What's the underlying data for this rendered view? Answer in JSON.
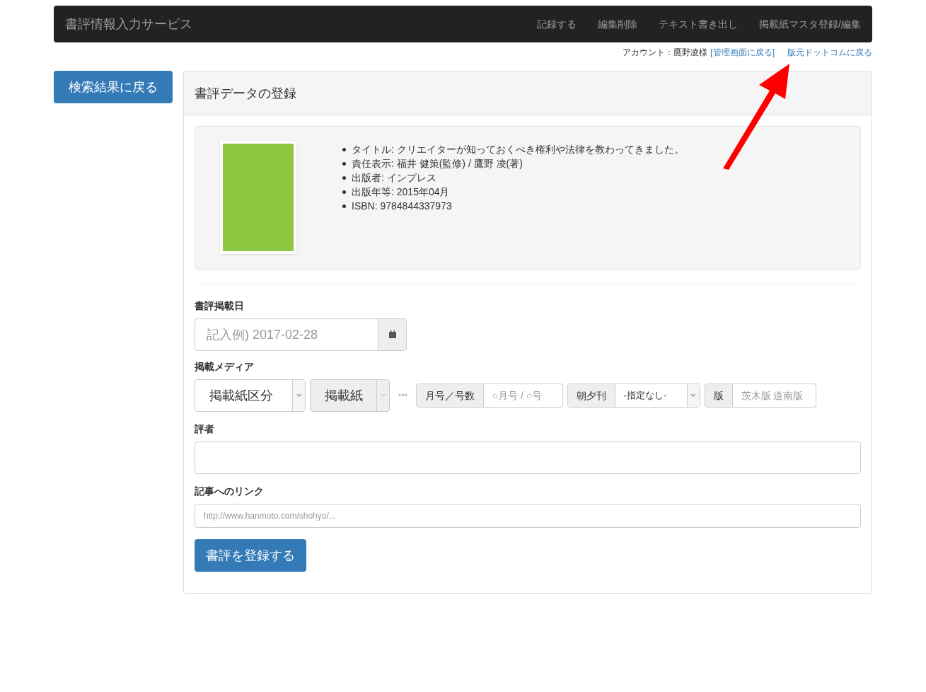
{
  "navbar": {
    "brand": "書評情報入力サービス",
    "items": [
      "記録する",
      "編集削除",
      "テキスト書き出し",
      "掲載紙マスタ登録/編集"
    ]
  },
  "account": {
    "label": "アカウント：鷹野凌様",
    "admin_link": "[管理画面に戻る]",
    "home_link": "版元ドットコムに戻る"
  },
  "back_button": "検索結果に戻る",
  "panel": {
    "title": "書評データの登録",
    "book": [
      "タイトル: クリエイターが知っておくべき権利や法律を教わってきました。",
      "責任表示: 福井 健策(監修) / 鷹野 凌(著)",
      "出版者: インプレス",
      "出版年等: 2015年04月",
      "ISBN: 9784844337973"
    ],
    "date": {
      "label": "書評掲載日",
      "placeholder": "記入例) 2017-02-28"
    },
    "media": {
      "label": "掲載メディア",
      "category": "掲載紙区分",
      "paper": "掲載紙",
      "paper_disabled": true,
      "ellipsis": "•••",
      "issue_label": "月号／号数",
      "issue_placeholder": "○月号 / ○号",
      "edition_time_label": "朝夕刊",
      "edition_time": "-指定なし-",
      "edition_label": "版",
      "edition_placeholder": "茨木版 道南版"
    },
    "reviewer": {
      "label": "評者"
    },
    "link": {
      "label": "記事へのリンク",
      "placeholder": "http://www.hanmoto.com/shohyo/..."
    },
    "submit": "書評を登録する"
  }
}
